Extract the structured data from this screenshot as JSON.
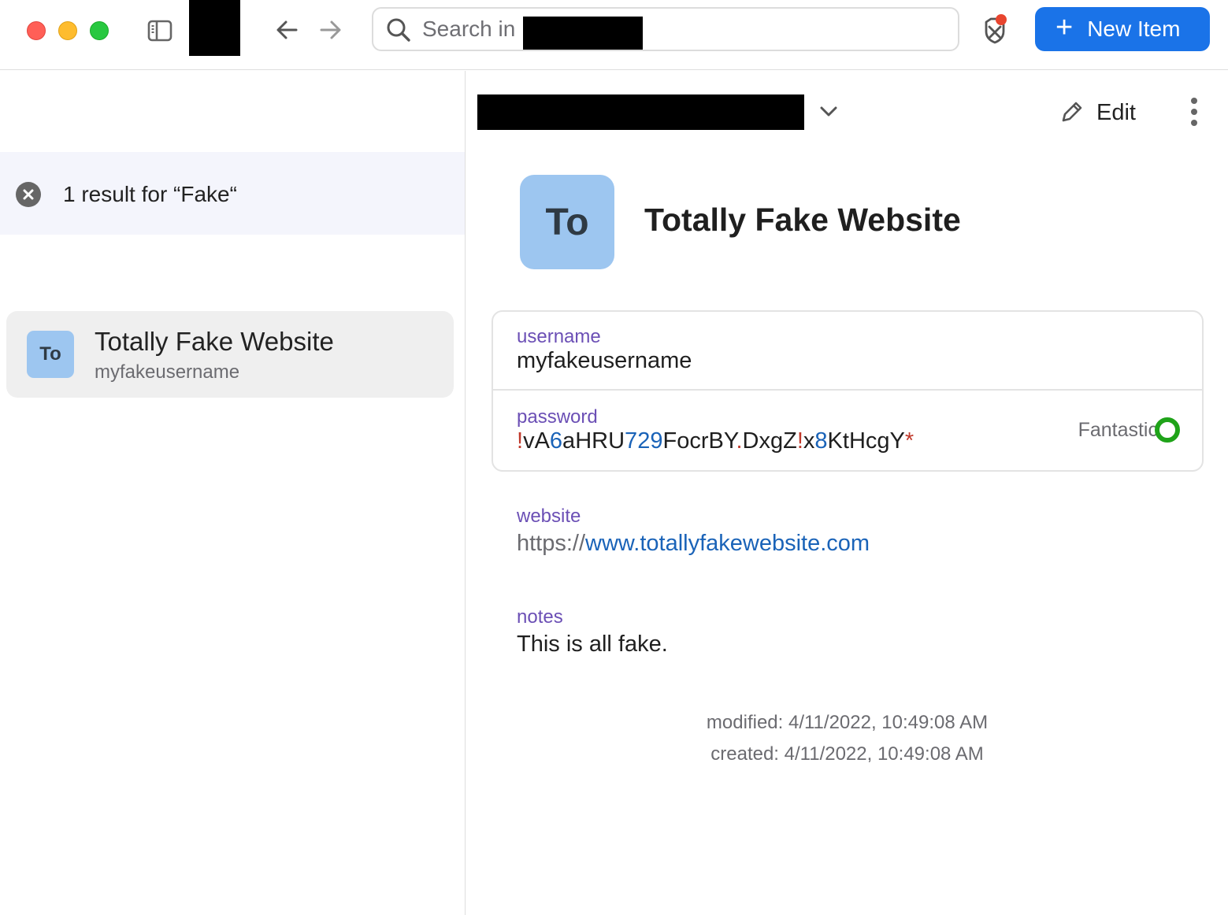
{
  "titlebar": {
    "search_placeholder": "Search in",
    "new_item_label": "New Item",
    "new_item_icon": "plus-icon"
  },
  "colors": {
    "accent": "#1a73e8",
    "field_label": "#6b4fb5",
    "strength_good": "#1fa319",
    "item_icon_bg": "#9dc6f0"
  },
  "sidebar": {
    "result_text": "1 result for “Fake“",
    "items": [
      {
        "icon_text": "To",
        "title": "Totally Fake Website",
        "subtitle": "myfakeusername"
      }
    ]
  },
  "detail": {
    "edit_label": "Edit",
    "icon_text": "To",
    "title": "Totally Fake Website",
    "username_label": "username",
    "username_value": "myfakeusername",
    "password_label": "password",
    "password_value": "!vA6aHRU729FocrBY.DxgZ!x8KtHcgY*",
    "password_strength": "Fantastic",
    "website_label": "website",
    "website_scheme": "https://",
    "website_host": "www.totallyfakewebsite.com",
    "notes_label": "notes",
    "notes_value": "This is all fake.",
    "modified": "modified: 4/11/2022, 10:49:08 AM",
    "created": "created: 4/11/2022, 10:49:08 AM"
  }
}
